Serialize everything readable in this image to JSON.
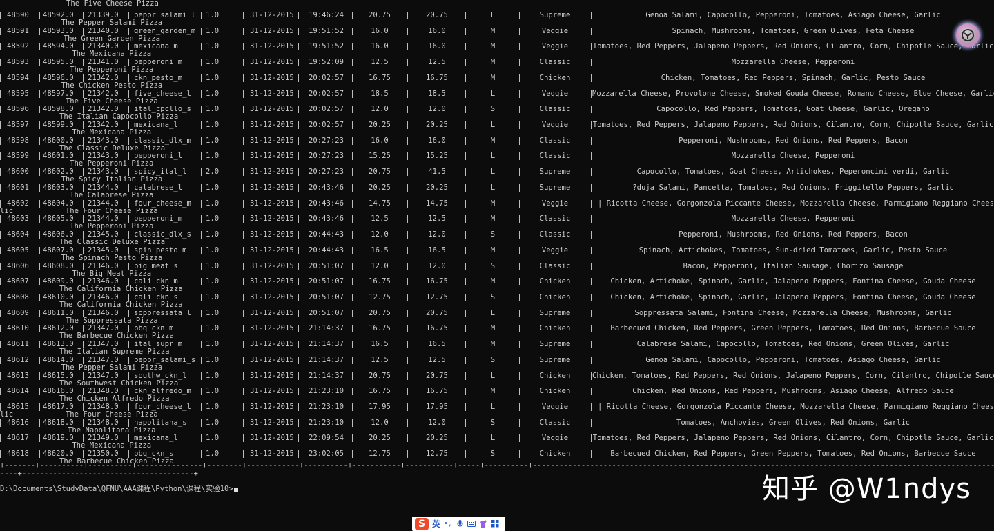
{
  "console": {
    "first_name": "The Five Cheese Pizza",
    "rows": [
      {
        "id": "48590",
        "oid": "48592.0",
        "order": "21339.0",
        "pizza": "peppr_salami_l",
        "qty": "1.0",
        "date": "31-12-2015",
        "time": "19:46:24",
        "unit": "20.75",
        "total": "20.75",
        "size": "L",
        "category": "Supreme",
        "ingredients": "Genoa Salami, Capocollo, Pepperoni, Tomatoes, Asiago Cheese, Garlic",
        "name": "The Pepper Salami Pizza"
      },
      {
        "id": "48591",
        "oid": "48593.0",
        "order": "21340.0",
        "pizza": "green_garden_m",
        "qty": "1.0",
        "date": "31-12-2015",
        "time": "19:51:52",
        "unit": "16.0",
        "total": "16.0",
        "size": "M",
        "category": "Veggie",
        "ingredients": "Spinach, Mushrooms, Tomatoes, Green Olives, Feta Cheese",
        "name": "The Green Garden Pizza"
      },
      {
        "id": "48592",
        "oid": "48594.0",
        "order": "21340.0",
        "pizza": "mexicana_m",
        "qty": "1.0",
        "date": "31-12-2015",
        "time": "19:51:52",
        "unit": "16.0",
        "total": "16.0",
        "size": "M",
        "category": "Veggie",
        "ingredients": "Tomatoes, Red Peppers, Jalapeno Peppers, Red Onions, Cilantro, Corn, Chipotle Sauce, Garlic",
        "name": "The Mexicana Pizza"
      },
      {
        "id": "48593",
        "oid": "48595.0",
        "order": "21341.0",
        "pizza": "pepperoni_m",
        "qty": "1.0",
        "date": "31-12-2015",
        "time": "19:52:09",
        "unit": "12.5",
        "total": "12.5",
        "size": "M",
        "category": "Classic",
        "ingredients": "Mozzarella Cheese, Pepperoni",
        "name": "The Pepperoni Pizza"
      },
      {
        "id": "48594",
        "oid": "48596.0",
        "order": "21342.0",
        "pizza": "ckn_pesto_m",
        "qty": "1.0",
        "date": "31-12-2015",
        "time": "20:02:57",
        "unit": "16.75",
        "total": "16.75",
        "size": "M",
        "category": "Chicken",
        "ingredients": "Chicken, Tomatoes, Red Peppers, Spinach, Garlic, Pesto Sauce",
        "name": "The Chicken Pesto Pizza"
      },
      {
        "id": "48595",
        "oid": "48597.0",
        "order": "21342.0",
        "pizza": "five_cheese_l",
        "qty": "1.0",
        "date": "31-12-2015",
        "time": "20:02:57",
        "unit": "18.5",
        "total": "18.5",
        "size": "L",
        "category": "Veggie",
        "ingredients": "Mozzarella Cheese, Provolone Cheese, Smoked Gouda Cheese, Romano Cheese, Blue Cheese, Garlic",
        "name": "The Five Cheese Pizza"
      },
      {
        "id": "48596",
        "oid": "48598.0",
        "order": "21342.0",
        "pizza": "ital_cpcllo_s",
        "qty": "1.0",
        "date": "31-12-2015",
        "time": "20:02:57",
        "unit": "12.0",
        "total": "12.0",
        "size": "S",
        "category": "Classic",
        "ingredients": "Capocollo, Red Peppers, Tomatoes, Goat Cheese, Garlic, Oregano",
        "name": "The Italian Capocollo Pizza"
      },
      {
        "id": "48597",
        "oid": "48599.0",
        "order": "21342.0",
        "pizza": "mexicana_l",
        "qty": "1.0",
        "date": "31-12-2015",
        "time": "20:02:57",
        "unit": "20.25",
        "total": "20.25",
        "size": "L",
        "category": "Veggie",
        "ingredients": "Tomatoes, Red Peppers, Jalapeno Peppers, Red Onions, Cilantro, Corn, Chipotle Sauce, Garlic",
        "name": "The Mexicana Pizza"
      },
      {
        "id": "48598",
        "oid": "48600.0",
        "order": "21343.0",
        "pizza": "classic_dlx_m",
        "qty": "1.0",
        "date": "31-12-2015",
        "time": "20:27:23",
        "unit": "16.0",
        "total": "16.0",
        "size": "M",
        "category": "Classic",
        "ingredients": "Pepperoni, Mushrooms, Red Onions, Red Peppers, Bacon",
        "name": "The Classic Deluxe Pizza"
      },
      {
        "id": "48599",
        "oid": "48601.0",
        "order": "21343.0",
        "pizza": "pepperoni_l",
        "qty": "1.0",
        "date": "31-12-2015",
        "time": "20:27:23",
        "unit": "15.25",
        "total": "15.25",
        "size": "L",
        "category": "Classic",
        "ingredients": "Mozzarella Cheese, Pepperoni",
        "name": "The Pepperoni Pizza"
      },
      {
        "id": "48600",
        "oid": "48602.0",
        "order": "21343.0",
        "pizza": "spicy_ital_l",
        "qty": "2.0",
        "date": "31-12-2015",
        "time": "20:27:23",
        "unit": "20.75",
        "total": "41.5",
        "size": "L",
        "category": "Supreme",
        "ingredients": "Capocollo, Tomatoes, Goat Cheese, Artichokes, Peperoncini verdi, Garlic",
        "name": "The Spicy Italian Pizza"
      },
      {
        "id": "48601",
        "oid": "48603.0",
        "order": "21344.0",
        "pizza": "calabrese_l",
        "qty": "1.0",
        "date": "31-12-2015",
        "time": "20:43:46",
        "unit": "20.25",
        "total": "20.25",
        "size": "L",
        "category": "Supreme",
        "ingredients": "?duja Salami, Pancetta, Tomatoes, Red Onions, Friggitello Peppers, Garlic",
        "name": "The Calabrese Pizza"
      },
      {
        "id": "48602",
        "oid": "48604.0",
        "order": "21344.0",
        "pizza": "four_cheese_m",
        "qty": "1.0",
        "date": "31-12-2015",
        "time": "20:43:46",
        "unit": "14.75",
        "total": "14.75",
        "size": "M",
        "category": "Veggie",
        "ingredients": "| Ricotta Cheese, Gorgonzola Piccante Cheese, Mozzarella Cheese, Parmigiano Reggiano Cheese, Gar",
        "wrap": "lic",
        "name": "The Four Cheese Pizza"
      },
      {
        "id": "48603",
        "oid": "48605.0",
        "order": "21344.0",
        "pizza": "pepperoni_m",
        "qty": "1.0",
        "date": "31-12-2015",
        "time": "20:43:46",
        "unit": "12.5",
        "total": "12.5",
        "size": "M",
        "category": "Classic",
        "ingredients": "Mozzarella Cheese, Pepperoni",
        "name": "The Pepperoni Pizza"
      },
      {
        "id": "48604",
        "oid": "48606.0",
        "order": "21345.0",
        "pizza": "classic_dlx_s",
        "qty": "1.0",
        "date": "31-12-2015",
        "time": "20:44:43",
        "unit": "12.0",
        "total": "12.0",
        "size": "S",
        "category": "Classic",
        "ingredients": "Pepperoni, Mushrooms, Red Onions, Red Peppers, Bacon",
        "name": "The Classic Deluxe Pizza"
      },
      {
        "id": "48605",
        "oid": "48607.0",
        "order": "21345.0",
        "pizza": "spin_pesto_m",
        "qty": "1.0",
        "date": "31-12-2015",
        "time": "20:44:43",
        "unit": "16.5",
        "total": "16.5",
        "size": "M",
        "category": "Veggie",
        "ingredients": "Spinach, Artichokes, Tomatoes, Sun-dried Tomatoes, Garlic, Pesto Sauce",
        "name": "The Spinach Pesto Pizza"
      },
      {
        "id": "48606",
        "oid": "48608.0",
        "order": "21346.0",
        "pizza": "big_meat_s",
        "qty": "1.0",
        "date": "31-12-2015",
        "time": "20:51:07",
        "unit": "12.0",
        "total": "12.0",
        "size": "S",
        "category": "Classic",
        "ingredients": "Bacon, Pepperoni, Italian Sausage, Chorizo Sausage",
        "name": "The Big Meat Pizza"
      },
      {
        "id": "48607",
        "oid": "48609.0",
        "order": "21346.0",
        "pizza": "cali_ckn_m",
        "qty": "1.0",
        "date": "31-12-2015",
        "time": "20:51:07",
        "unit": "16.75",
        "total": "16.75",
        "size": "M",
        "category": "Chicken",
        "ingredients": "Chicken, Artichoke, Spinach, Garlic, Jalapeno Peppers, Fontina Cheese, Gouda Cheese",
        "name": "The California Chicken Pizza"
      },
      {
        "id": "48608",
        "oid": "48610.0",
        "order": "21346.0",
        "pizza": "cali_ckn_s",
        "qty": "1.0",
        "date": "31-12-2015",
        "time": "20:51:07",
        "unit": "12.75",
        "total": "12.75",
        "size": "S",
        "category": "Chicken",
        "ingredients": "Chicken, Artichoke, Spinach, Garlic, Jalapeno Peppers, Fontina Cheese, Gouda Cheese",
        "name": "The California Chicken Pizza"
      },
      {
        "id": "48609",
        "oid": "48611.0",
        "order": "21346.0",
        "pizza": "soppressata_l",
        "qty": "1.0",
        "date": "31-12-2015",
        "time": "20:51:07",
        "unit": "20.75",
        "total": "20.75",
        "size": "L",
        "category": "Supreme",
        "ingredients": "Soppressata Salami, Fontina Cheese, Mozzarella Cheese, Mushrooms, Garlic",
        "name": "The Soppressata Pizza"
      },
      {
        "id": "48610",
        "oid": "48612.0",
        "order": "21347.0",
        "pizza": "bbq_ckn_m",
        "qty": "1.0",
        "date": "31-12-2015",
        "time": "21:14:37",
        "unit": "16.75",
        "total": "16.75",
        "size": "M",
        "category": "Chicken",
        "ingredients": "Barbecued Chicken, Red Peppers, Green Peppers, Tomatoes, Red Onions, Barbecue Sauce",
        "name": "The Barbecue Chicken Pizza"
      },
      {
        "id": "48611",
        "oid": "48613.0",
        "order": "21347.0",
        "pizza": "ital_supr_m",
        "qty": "1.0",
        "date": "31-12-2015",
        "time": "21:14:37",
        "unit": "16.5",
        "total": "16.5",
        "size": "M",
        "category": "Supreme",
        "ingredients": "Calabrese Salami, Capocollo, Tomatoes, Red Onions, Green Olives, Garlic",
        "name": "The Italian Supreme Pizza"
      },
      {
        "id": "48612",
        "oid": "48614.0",
        "order": "21347.0",
        "pizza": "peppr_salami_s",
        "qty": "1.0",
        "date": "31-12-2015",
        "time": "21:14:37",
        "unit": "12.5",
        "total": "12.5",
        "size": "S",
        "category": "Supreme",
        "ingredients": "Genoa Salami, Capocollo, Pepperoni, Tomatoes, Asiago Cheese, Garlic",
        "name": "The Pepper Salami Pizza"
      },
      {
        "id": "48613",
        "oid": "48615.0",
        "order": "21347.0",
        "pizza": "southw_ckn_l",
        "qty": "1.0",
        "date": "31-12-2015",
        "time": "21:14:37",
        "unit": "20.75",
        "total": "20.75",
        "size": "L",
        "category": "Chicken",
        "ingredients": "Chicken, Tomatoes, Red Peppers, Red Onions, Jalapeno Peppers, Corn, Cilantro, Chipotle Sauce",
        "name": "The Southwest Chicken Pizza"
      },
      {
        "id": "48614",
        "oid": "48616.0",
        "order": "21348.0",
        "pizza": "ckn_alfredo_m",
        "qty": "1.0",
        "date": "31-12-2015",
        "time": "21:23:10",
        "unit": "16.75",
        "total": "16.75",
        "size": "M",
        "category": "Chicken",
        "ingredients": "Chicken, Red Onions, Red Peppers, Mushrooms, Asiago Cheese, Alfredo Sauce",
        "name": "The Chicken Alfredo Pizza"
      },
      {
        "id": "48615",
        "oid": "48617.0",
        "order": "21348.0",
        "pizza": "four_cheese_l",
        "qty": "1.0",
        "date": "31-12-2015",
        "time": "21:23:10",
        "unit": "17.95",
        "total": "17.95",
        "size": "L",
        "category": "Veggie",
        "ingredients": "| Ricotta Cheese, Gorgonzola Piccante Cheese, Mozzarella Cheese, Parmigiano Reggiano Cheese, Gar",
        "wrap": "lic",
        "name": "The Four Cheese Pizza"
      },
      {
        "id": "48616",
        "oid": "48618.0",
        "order": "21348.0",
        "pizza": "napolitana_s",
        "qty": "1.0",
        "date": "31-12-2015",
        "time": "21:23:10",
        "unit": "12.0",
        "total": "12.0",
        "size": "S",
        "category": "Classic",
        "ingredients": "Tomatoes, Anchovies, Green Olives, Red Onions, Garlic",
        "name": "The Napolitana Pizza"
      },
      {
        "id": "48617",
        "oid": "48619.0",
        "order": "21349.0",
        "pizza": "mexicana_l",
        "qty": "1.0",
        "date": "31-12-2015",
        "time": "22:09:54",
        "unit": "20.25",
        "total": "20.25",
        "size": "L",
        "category": "Veggie",
        "ingredients": "Tomatoes, Red Peppers, Jalapeno Peppers, Red Onions, Cilantro, Corn, Chipotle Sauce, Garlic",
        "name": "The Mexicana Pizza"
      },
      {
        "id": "48618",
        "oid": "48620.0",
        "order": "21350.0",
        "pizza": "bbq_ckn_s",
        "qty": "1.0",
        "date": "31-12-2015",
        "time": "23:02:05",
        "unit": "12.75",
        "total": "12.75",
        "size": "S",
        "category": "Chicken",
        "ingredients": "Barbecued Chicken, Red Peppers, Green Peppers, Tomatoes, Red Onions, Barbecue Sauce",
        "name": "The Barbecue Chicken Pizza"
      }
    ],
    "separator_top": "+-------+----------+----------+---------------+--------+------------+----------+-----------+-----------+-----+----------+------------------------------------------------------------------------------------------------------------",
    "separator_bottom": "----+---------------------------------------+",
    "prompt": "D:\\Documents\\StudyData\\QFNU\\AAA课程\\Python\\课程\\实验10>"
  },
  "watermark": "知乎 @W1ndys",
  "ime": {
    "lang_label": "英",
    "logo": "S"
  },
  "colors": {
    "background": "#0c0c0c",
    "text": "#cccccc",
    "ime_logo": "#ef4b2a",
    "ime_icons": "#2156c9"
  }
}
